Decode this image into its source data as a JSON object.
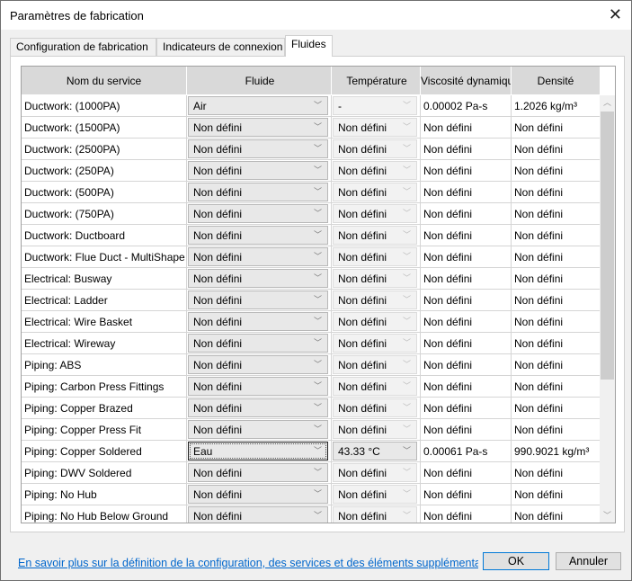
{
  "window": {
    "title": "Paramètres de fabrication"
  },
  "tabs": [
    {
      "label": "Configuration de fabrication"
    },
    {
      "label": "Indicateurs de connexion"
    },
    {
      "label": "Fluides",
      "active": true
    }
  ],
  "grid": {
    "headers": [
      "Nom du service",
      "Fluide",
      "Température",
      "Viscosité dynamique",
      "Densité"
    ],
    "rows": [
      {
        "name": "Ductwork: (1000PA)",
        "fluid": "Air",
        "temp": "-",
        "visc": "0.00002 Pa-s",
        "dens": "1.2026 kg/m³"
      },
      {
        "name": "Ductwork: (1500PA)",
        "fluid": "Non défini",
        "temp": "Non défini",
        "visc": "Non défini",
        "dens": "Non défini"
      },
      {
        "name": "Ductwork: (2500PA)",
        "fluid": "Non défini",
        "temp": "Non défini",
        "visc": "Non défini",
        "dens": "Non défini"
      },
      {
        "name": "Ductwork: (250PA)",
        "fluid": "Non défini",
        "temp": "Non défini",
        "visc": "Non défini",
        "dens": "Non défini"
      },
      {
        "name": "Ductwork: (500PA)",
        "fluid": "Non défini",
        "temp": "Non défini",
        "visc": "Non défini",
        "dens": "Non défini"
      },
      {
        "name": "Ductwork: (750PA)",
        "fluid": "Non défini",
        "temp": "Non défini",
        "visc": "Non défini",
        "dens": "Non défini"
      },
      {
        "name": "Ductwork: Ductboard",
        "fluid": "Non défini",
        "temp": "Non défini",
        "visc": "Non défini",
        "dens": "Non défini"
      },
      {
        "name": "Ductwork: Flue Duct - MultiShape",
        "fluid": "Non défini",
        "temp": "Non défini",
        "visc": "Non défini",
        "dens": "Non défini"
      },
      {
        "name": "Electrical: Busway",
        "fluid": "Non défini",
        "temp": "Non défini",
        "visc": "Non défini",
        "dens": "Non défini"
      },
      {
        "name": "Electrical: Ladder",
        "fluid": "Non défini",
        "temp": "Non défini",
        "visc": "Non défini",
        "dens": "Non défini"
      },
      {
        "name": "Electrical: Wire Basket",
        "fluid": "Non défini",
        "temp": "Non défini",
        "visc": "Non défini",
        "dens": "Non défini"
      },
      {
        "name": "Electrical: Wireway",
        "fluid": "Non défini",
        "temp": "Non défini",
        "visc": "Non défini",
        "dens": "Non défini"
      },
      {
        "name": "Piping: ABS",
        "fluid": "Non défini",
        "temp": "Non défini",
        "visc": "Non défini",
        "dens": "Non défini"
      },
      {
        "name": "Piping: Carbon Press Fittings",
        "fluid": "Non défini",
        "temp": "Non défini",
        "visc": "Non défini",
        "dens": "Non défini"
      },
      {
        "name": "Piping: Copper Brazed",
        "fluid": "Non défini",
        "temp": "Non défini",
        "visc": "Non défini",
        "dens": "Non défini"
      },
      {
        "name": "Piping: Copper Press Fit",
        "fluid": "Non défini",
        "temp": "Non défini",
        "visc": "Non défini",
        "dens": "Non défini"
      },
      {
        "name": "Piping: Copper Soldered",
        "fluid": "Eau",
        "temp": "43.33 °C",
        "visc": "0.00061 Pa-s",
        "dens": "990.9021 kg/m³",
        "focused": true,
        "tempEnabled": true
      },
      {
        "name": "Piping: DWV Soldered",
        "fluid": "Non défini",
        "temp": "Non défini",
        "visc": "Non défini",
        "dens": "Non défini"
      },
      {
        "name": "Piping: No Hub",
        "fluid": "Non défini",
        "temp": "Non défini",
        "visc": "Non défini",
        "dens": "Non défini"
      },
      {
        "name": "Piping: No Hub Below Ground",
        "fluid": "Non défini",
        "temp": "Non défini",
        "visc": "Non défini",
        "dens": "Non défini"
      }
    ]
  },
  "footer": {
    "link": "En savoir plus sur la définition de la configuration, des services et des éléments supplémentaires de fabrication",
    "ok": "OK",
    "cancel": "Annuler"
  }
}
